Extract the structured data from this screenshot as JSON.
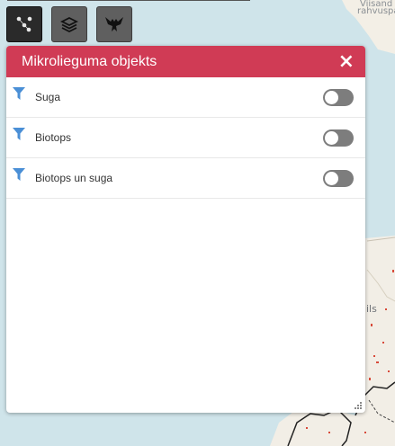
{
  "map": {
    "labels": [
      "Viisand",
      "rahvuspa",
      "ils"
    ]
  },
  "toolbar": {
    "buttons": [
      {
        "icon": "network-nodes-icon"
      },
      {
        "icon": "layers-icon"
      },
      {
        "icon": "eagle-icon"
      }
    ]
  },
  "panel": {
    "title": "Mikrolieguma objekts",
    "close_label": "×",
    "header_color": "#d03b55",
    "filter_icon_color": "#4a8fd6",
    "toggle_color": "#7d7d7d",
    "items": [
      {
        "label": "Suga",
        "enabled": false
      },
      {
        "label": "Biotops",
        "enabled": false
      },
      {
        "label": "Biotops un suga",
        "enabled": false
      }
    ]
  }
}
